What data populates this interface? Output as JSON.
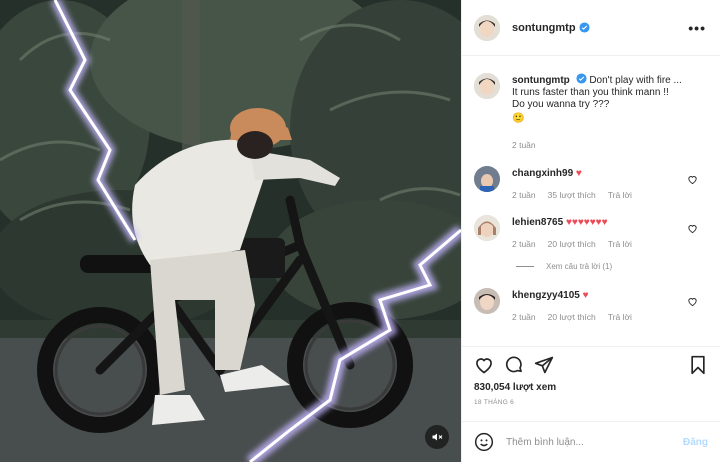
{
  "header": {
    "username": "sontungmtp",
    "more_label": "•••"
  },
  "caption": {
    "username": "sontungmtp",
    "line1": "Don't play with fire ...",
    "line2": "It runs faster than you think mann !!",
    "line3": "Do you wanna try ???",
    "emoji": "🙂",
    "time": "2 tuần"
  },
  "comments": [
    {
      "username": "changxinh99",
      "text": "♥",
      "time": "2 tuần",
      "likes": "35 lượt thích",
      "reply": "Trả lời"
    },
    {
      "username": "lehien8765",
      "text": "♥♥♥♥♥♥♥",
      "time": "2 tuần",
      "likes": "20 lượt thích",
      "reply": "Trả lời",
      "view_replies": "Xem câu trả lời (1)"
    },
    {
      "username": "khengzyy4105",
      "text": "♥",
      "time": "2 tuần",
      "likes": "20 lượt thích",
      "reply": "Trả lời"
    }
  ],
  "stats": {
    "views": "830,054 lượt xem",
    "date": "18 THÁNG 6"
  },
  "add_comment": {
    "placeholder": "Thêm bình luận...",
    "post_label": "Đăng"
  },
  "colors": {
    "verified": "#3897f0",
    "heart": "#ed4956",
    "muted": "#8e8e8e",
    "post_disabled": "#b3dbff"
  }
}
